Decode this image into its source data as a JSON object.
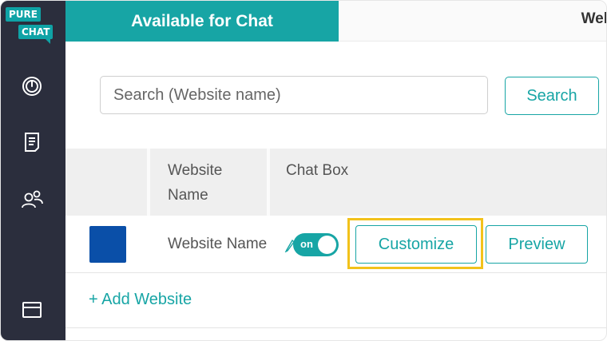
{
  "sidebar": {
    "logo_line1": "PURE",
    "logo_line2": "CHAT",
    "items": [
      {
        "icon": "dashboard-gauge-icon"
      },
      {
        "icon": "document-icon"
      },
      {
        "icon": "users-icon"
      },
      {
        "icon": "card-icon"
      }
    ]
  },
  "header": {
    "active_tab": "Available for Chat",
    "right_text": "Wel"
  },
  "search": {
    "placeholder": "Search (Website name)",
    "value": "",
    "button_label": "Search"
  },
  "table": {
    "columns": [
      "",
      "Website Name",
      "Chat Box"
    ],
    "column1_line1": "Website",
    "column1_line2": "Name",
    "rows": [
      {
        "color": "#0a4fa8",
        "name": "Website Name",
        "toggle_label": "on",
        "customize_label": "Customize",
        "preview_label": "Preview"
      }
    ]
  },
  "add_website_label": "+ Add Website",
  "colors": {
    "accent": "#17a5a5",
    "sidebar": "#2b2e3d",
    "highlight": "#f2c21b"
  }
}
